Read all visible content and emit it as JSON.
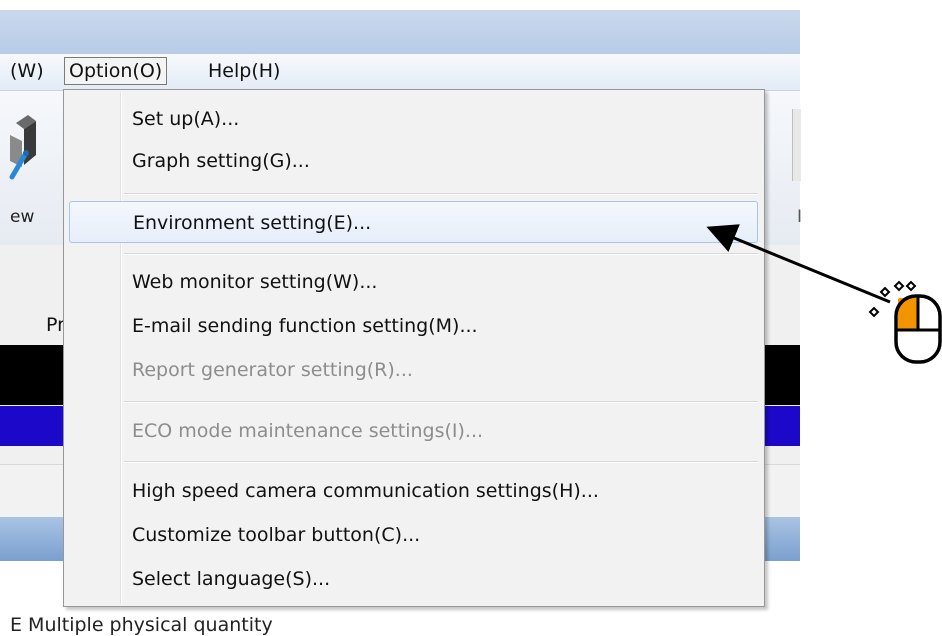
{
  "menubar": {
    "items": [
      {
        "label": "(W)"
      },
      {
        "label": "Option(O)"
      },
      {
        "label": "Help(H)"
      }
    ]
  },
  "toolbar": {
    "left_label": "ew",
    "right_label": "I"
  },
  "panel": {
    "pr_label": "Pr"
  },
  "bottom": {
    "text": "E    Multiple physical quantity"
  },
  "option_menu": {
    "items": [
      {
        "label": "Set up(A)...",
        "enabled": true
      },
      {
        "label": "Graph setting(G)...",
        "enabled": true
      },
      {
        "label": "Environment setting(E)...",
        "enabled": true,
        "highlighted": true
      },
      {
        "label": "Web monitor setting(W)...",
        "enabled": true
      },
      {
        "label": "E-mail sending function setting(M)...",
        "enabled": true
      },
      {
        "label": "Report generator setting(R)...",
        "enabled": false
      },
      {
        "label": "ECO mode maintenance settings(I)...",
        "enabled": false
      },
      {
        "label": "High speed camera communication settings(H)...",
        "enabled": true
      },
      {
        "label": "Customize toolbar button(C)...",
        "enabled": true
      },
      {
        "label": "Select language(S)...",
        "enabled": true
      }
    ]
  },
  "annotation": {
    "arrow_color": "#000000",
    "mouse_icon": "mouse-left-click-icon",
    "click_highlight_color": "#f29400"
  }
}
